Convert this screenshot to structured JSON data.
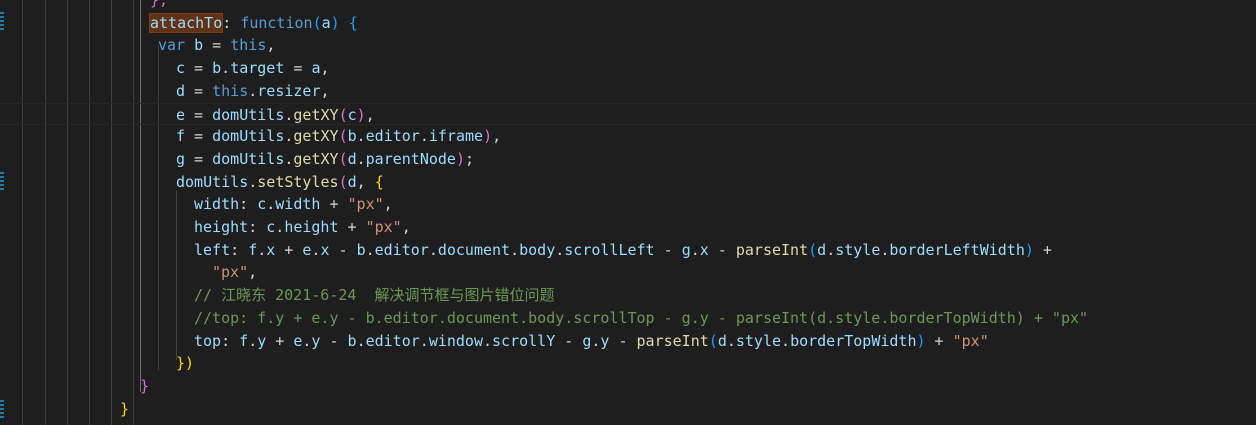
{
  "editor": {
    "lines": [
      {
        "indent": 150,
        "tokens": [
          {
            "t": "},",
            "c": "t-b2"
          }
        ]
      },
      {
        "indent": 150,
        "tokens": [
          {
            "t": "attachTo",
            "c": "t-prop hl"
          },
          {
            "t": ": ",
            "c": "t-op"
          },
          {
            "t": "function",
            "c": "t-kw"
          },
          {
            "t": "(",
            "c": "t-b3"
          },
          {
            "t": "a",
            "c": "t-var"
          },
          {
            "t": ")",
            "c": "t-b3"
          },
          {
            "t": " ",
            "c": "t-op"
          },
          {
            "t": "{",
            "c": "t-b3"
          }
        ]
      },
      {
        "indent": 158,
        "tokens": [
          {
            "t": "var",
            "c": "t-kw"
          },
          {
            "t": " ",
            "c": "t-op"
          },
          {
            "t": "b",
            "c": "t-var"
          },
          {
            "t": " = ",
            "c": "t-op"
          },
          {
            "t": "this",
            "c": "t-kw"
          },
          {
            "t": ",",
            "c": "t-op"
          }
        ]
      },
      {
        "indent": 176,
        "tokens": [
          {
            "t": "c",
            "c": "t-var"
          },
          {
            "t": " = ",
            "c": "t-op"
          },
          {
            "t": "b",
            "c": "t-var"
          },
          {
            "t": ".",
            "c": "t-op"
          },
          {
            "t": "target",
            "c": "t-prop"
          },
          {
            "t": " = ",
            "c": "t-op"
          },
          {
            "t": "a",
            "c": "t-var"
          },
          {
            "t": ",",
            "c": "t-op"
          }
        ]
      },
      {
        "indent": 176,
        "tokens": [
          {
            "t": "d",
            "c": "t-var"
          },
          {
            "t": " = ",
            "c": "t-op"
          },
          {
            "t": "this",
            "c": "t-kw"
          },
          {
            "t": ".",
            "c": "t-op"
          },
          {
            "t": "resizer",
            "c": "t-prop"
          },
          {
            "t": ",",
            "c": "t-op"
          }
        ]
      },
      {
        "indent": 176,
        "current": true,
        "tokens": [
          {
            "t": "e",
            "c": "t-var"
          },
          {
            "t": " = ",
            "c": "t-op"
          },
          {
            "t": "domUtils",
            "c": "t-var"
          },
          {
            "t": ".",
            "c": "t-op"
          },
          {
            "t": "getXY",
            "c": "t-fn"
          },
          {
            "t": "(",
            "c": "t-b2"
          },
          {
            "t": "c",
            "c": "t-var"
          },
          {
            "t": ")",
            "c": "t-b2"
          },
          {
            "t": ",",
            "c": "t-op"
          }
        ]
      },
      {
        "indent": 176,
        "tokens": [
          {
            "t": "f",
            "c": "t-var"
          },
          {
            "t": " = ",
            "c": "t-op"
          },
          {
            "t": "domUtils",
            "c": "t-var"
          },
          {
            "t": ".",
            "c": "t-op"
          },
          {
            "t": "getXY",
            "c": "t-fn"
          },
          {
            "t": "(",
            "c": "t-b2"
          },
          {
            "t": "b",
            "c": "t-var"
          },
          {
            "t": ".",
            "c": "t-op"
          },
          {
            "t": "editor",
            "c": "t-prop"
          },
          {
            "t": ".",
            "c": "t-op"
          },
          {
            "t": "iframe",
            "c": "t-prop"
          },
          {
            "t": ")",
            "c": "t-b2"
          },
          {
            "t": ",",
            "c": "t-op"
          }
        ]
      },
      {
        "indent": 176,
        "tokens": [
          {
            "t": "g",
            "c": "t-var"
          },
          {
            "t": " = ",
            "c": "t-op"
          },
          {
            "t": "domUtils",
            "c": "t-var"
          },
          {
            "t": ".",
            "c": "t-op"
          },
          {
            "t": "getXY",
            "c": "t-fn"
          },
          {
            "t": "(",
            "c": "t-b2"
          },
          {
            "t": "d",
            "c": "t-var"
          },
          {
            "t": ".",
            "c": "t-op"
          },
          {
            "t": "parentNode",
            "c": "t-prop"
          },
          {
            "t": ")",
            "c": "t-b2"
          },
          {
            "t": ";",
            "c": "t-op"
          }
        ]
      },
      {
        "indent": 176,
        "tokens": [
          {
            "t": "domUtils",
            "c": "t-var"
          },
          {
            "t": ".",
            "c": "t-op"
          },
          {
            "t": "setStyles",
            "c": "t-fn"
          },
          {
            "t": "(",
            "c": "t-b2"
          },
          {
            "t": "d",
            "c": "t-var"
          },
          {
            "t": ", ",
            "c": "t-op"
          },
          {
            "t": "{",
            "c": "t-b1"
          }
        ]
      },
      {
        "indent": 194,
        "tokens": [
          {
            "t": "width",
            "c": "t-prop"
          },
          {
            "t": ": ",
            "c": "t-op"
          },
          {
            "t": "c",
            "c": "t-var"
          },
          {
            "t": ".",
            "c": "t-op"
          },
          {
            "t": "width",
            "c": "t-prop"
          },
          {
            "t": " + ",
            "c": "t-op"
          },
          {
            "t": "\"px\"",
            "c": "t-str"
          },
          {
            "t": ",",
            "c": "t-op"
          }
        ]
      },
      {
        "indent": 194,
        "tokens": [
          {
            "t": "height",
            "c": "t-prop"
          },
          {
            "t": ": ",
            "c": "t-op"
          },
          {
            "t": "c",
            "c": "t-var"
          },
          {
            "t": ".",
            "c": "t-op"
          },
          {
            "t": "height",
            "c": "t-prop"
          },
          {
            "t": " + ",
            "c": "t-op"
          },
          {
            "t": "\"px\"",
            "c": "t-str"
          },
          {
            "t": ",",
            "c": "t-op"
          }
        ]
      },
      {
        "indent": 194,
        "tokens": [
          {
            "t": "left",
            "c": "t-prop"
          },
          {
            "t": ": ",
            "c": "t-op"
          },
          {
            "t": "f",
            "c": "t-var"
          },
          {
            "t": ".",
            "c": "t-op"
          },
          {
            "t": "x",
            "c": "t-prop"
          },
          {
            "t": " + ",
            "c": "t-op"
          },
          {
            "t": "e",
            "c": "t-var"
          },
          {
            "t": ".",
            "c": "t-op"
          },
          {
            "t": "x",
            "c": "t-prop"
          },
          {
            "t": " - ",
            "c": "t-op"
          },
          {
            "t": "b",
            "c": "t-var"
          },
          {
            "t": ".",
            "c": "t-op"
          },
          {
            "t": "editor",
            "c": "t-prop"
          },
          {
            "t": ".",
            "c": "t-op"
          },
          {
            "t": "document",
            "c": "t-prop"
          },
          {
            "t": ".",
            "c": "t-op"
          },
          {
            "t": "body",
            "c": "t-prop"
          },
          {
            "t": ".",
            "c": "t-op"
          },
          {
            "t": "scrollLeft",
            "c": "t-prop"
          },
          {
            "t": " - ",
            "c": "t-op"
          },
          {
            "t": "g",
            "c": "t-var"
          },
          {
            "t": ".",
            "c": "t-op"
          },
          {
            "t": "x",
            "c": "t-prop"
          },
          {
            "t": " - ",
            "c": "t-op"
          },
          {
            "t": "parseInt",
            "c": "t-fn"
          },
          {
            "t": "(",
            "c": "t-b3"
          },
          {
            "t": "d",
            "c": "t-var"
          },
          {
            "t": ".",
            "c": "t-op"
          },
          {
            "t": "style",
            "c": "t-prop"
          },
          {
            "t": ".",
            "c": "t-op"
          },
          {
            "t": "borderLeftWidth",
            "c": "t-prop"
          },
          {
            "t": ")",
            "c": "t-b3"
          },
          {
            "t": " +",
            "c": "t-op"
          }
        ]
      },
      {
        "indent": 212,
        "tokens": [
          {
            "t": "\"px\"",
            "c": "t-str"
          },
          {
            "t": ",",
            "c": "t-op"
          }
        ]
      },
      {
        "indent": 194,
        "tokens": [
          {
            "t": "// 江晓东 2021-6-24  解决调节框与图片错位问题",
            "c": "t-cmt"
          }
        ]
      },
      {
        "indent": 194,
        "tokens": [
          {
            "t": "//top: f.y + e.y - b.editor.document.body.scrollTop - g.y - parseInt(d.style.borderTopWidth) + \"px\"",
            "c": "t-cmt"
          }
        ]
      },
      {
        "indent": 194,
        "tokens": [
          {
            "t": "top",
            "c": "t-prop"
          },
          {
            "t": ": ",
            "c": "t-op"
          },
          {
            "t": "f",
            "c": "t-var"
          },
          {
            "t": ".",
            "c": "t-op"
          },
          {
            "t": "y",
            "c": "t-prop"
          },
          {
            "t": " + ",
            "c": "t-op"
          },
          {
            "t": "e",
            "c": "t-var"
          },
          {
            "t": ".",
            "c": "t-op"
          },
          {
            "t": "y",
            "c": "t-prop"
          },
          {
            "t": " - ",
            "c": "t-op"
          },
          {
            "t": "b",
            "c": "t-var"
          },
          {
            "t": ".",
            "c": "t-op"
          },
          {
            "t": "editor",
            "c": "t-prop"
          },
          {
            "t": ".",
            "c": "t-op"
          },
          {
            "t": "window",
            "c": "t-prop"
          },
          {
            "t": ".",
            "c": "t-op"
          },
          {
            "t": "scrollY",
            "c": "t-prop"
          },
          {
            "t": " - ",
            "c": "t-op"
          },
          {
            "t": "g",
            "c": "t-var"
          },
          {
            "t": ".",
            "c": "t-op"
          },
          {
            "t": "y",
            "c": "t-prop"
          },
          {
            "t": " - ",
            "c": "t-op"
          },
          {
            "t": "parseInt",
            "c": "t-fn"
          },
          {
            "t": "(",
            "c": "t-b3"
          },
          {
            "t": "d",
            "c": "t-var"
          },
          {
            "t": ".",
            "c": "t-op"
          },
          {
            "t": "style",
            "c": "t-prop"
          },
          {
            "t": ".",
            "c": "t-op"
          },
          {
            "t": "borderTopWidth",
            "c": "t-prop"
          },
          {
            "t": ")",
            "c": "t-b3"
          },
          {
            "t": " + ",
            "c": "t-op"
          },
          {
            "t": "\"px\"",
            "c": "t-str"
          }
        ]
      },
      {
        "indent": 176,
        "tokens": [
          {
            "t": "})",
            "c": "t-b1"
          }
        ]
      },
      {
        "indent": 140,
        "tokens": [
          {
            "t": "}",
            "c": "t-b2"
          }
        ]
      },
      {
        "indent": 120,
        "tokens": [
          {
            "t": "}",
            "c": "t-b1"
          }
        ]
      }
    ]
  }
}
